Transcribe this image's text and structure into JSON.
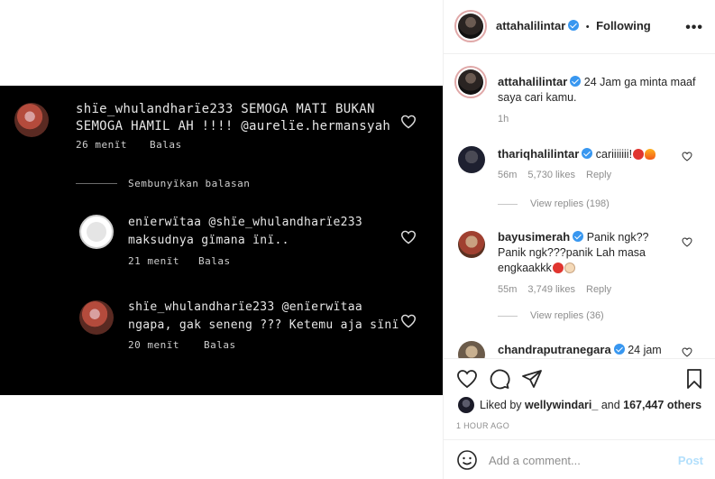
{
  "media": {
    "comment1": {
      "line1": "shïe_whulandharïe233 SEMOGA MATI BUKAN",
      "line2": "SEMOGA HAMIL AH !!!! @aurelïe.hermansyah",
      "time": "26 menït",
      "reply": "Balas"
    },
    "hide_replies": "Sembunyïkan balasan",
    "reply1": {
      "line1": "enïerwïtaa @shïe_whulandharïe233",
      "line2": "maksudnya gïmana ïnï..",
      "time": "21 menït",
      "reply": "Balas"
    },
    "reply2": {
      "line1": "shïe_whulandharïe233 @enïerwïtaa",
      "line2": "ngapa, gak seneng ??? Ketemu aja sïnï",
      "time": "20 menït",
      "reply": "Balas"
    }
  },
  "header": {
    "username": "attahalilintar",
    "separator": "•",
    "following": "Following",
    "more": "•••"
  },
  "caption": {
    "username": "attahalilintar",
    "text_line1": "24 Jam ga minta maaf",
    "text_line2": "saya cari kamu.",
    "time": "1h"
  },
  "comments": [
    {
      "username": "thariqhalilintar",
      "text": "cariiiiiii!",
      "time": "56m",
      "likes": "5,730 likes",
      "reply": "Reply",
      "view_replies": "View replies (198)"
    },
    {
      "username": "bayusimerah",
      "text_line1": "Panik ngk??",
      "text_line2": "Panik ngk???panik Lah masa",
      "text_line3": "engkaakkk",
      "time": "55m",
      "likes": "3,749 likes",
      "reply": "Reply",
      "view_replies": "View replies (36)"
    },
    {
      "username": "chandraputranegara",
      "text": "24 jam"
    }
  ],
  "likes": {
    "prefix": "Liked by",
    "user": "wellywindari_",
    "and": "and",
    "count": "167,447 others"
  },
  "post_time": "1 HOUR AGO",
  "add_comment": {
    "placeholder": "Add a comment...",
    "post": "Post"
  },
  "colors": {
    "verified": "#3897f0",
    "post_disabled": "#b2dffc",
    "muted": "#8e8e8e"
  }
}
